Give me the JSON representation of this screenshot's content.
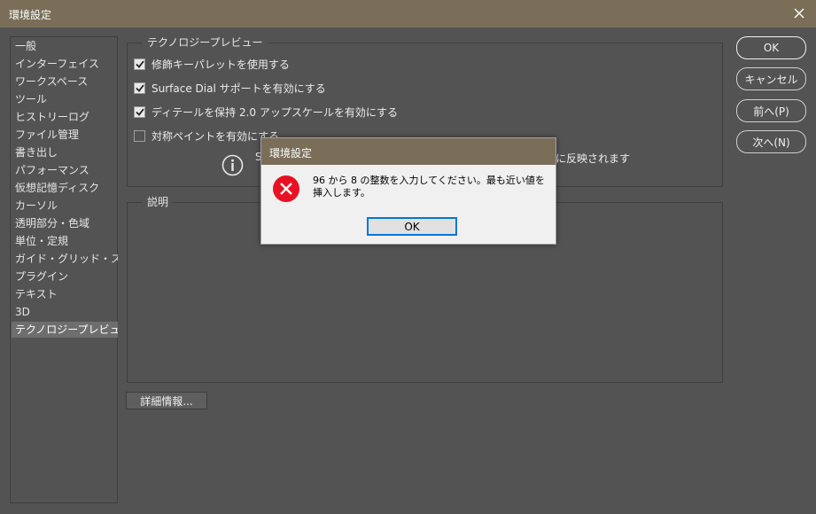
{
  "window": {
    "title": "環境設定"
  },
  "sidebar": {
    "items": [
      {
        "label": "一般"
      },
      {
        "label": "インターフェイス"
      },
      {
        "label": "ワークスペース"
      },
      {
        "label": "ツール"
      },
      {
        "label": "ヒストリーログ"
      },
      {
        "label": "ファイル管理"
      },
      {
        "label": "書き出し"
      },
      {
        "label": "パフォーマンス"
      },
      {
        "label": "仮想記憶ディスク"
      },
      {
        "label": "カーソル"
      },
      {
        "label": "透明部分・色域"
      },
      {
        "label": "単位・定規"
      },
      {
        "label": "ガイド・グリッド・スライス"
      },
      {
        "label": "プラグイン"
      },
      {
        "label": "テキスト"
      },
      {
        "label": "3D"
      },
      {
        "label": "テクノロジープレビュー",
        "active": true
      }
    ]
  },
  "tech_preview": {
    "group_label": "テクノロジープレビュー",
    "options": [
      {
        "label": "修飾キーパレットを使用する",
        "checked": true
      },
      {
        "label": "Surface Dial サポートを有効にする",
        "checked": true
      },
      {
        "label": "ディテールを保持 2.0 アップスケールを有効にする",
        "checked": true
      },
      {
        "label": "対称ペイントを有効にする",
        "checked": false
      }
    ],
    "info_left": "S",
    "info_right": "に反映されます"
  },
  "description": {
    "group_label": "説明"
  },
  "details_button": {
    "label": "詳細情報..."
  },
  "buttons": {
    "ok": "OK",
    "cancel": "キャンセル",
    "prev": "前へ(P)",
    "next": "次へ(N)"
  },
  "modal": {
    "title": "環境設定",
    "message": "96 から 8 の整数を入力してください。最も近い値を挿入します。",
    "ok_label": "OK",
    "icon": "error-icon"
  }
}
